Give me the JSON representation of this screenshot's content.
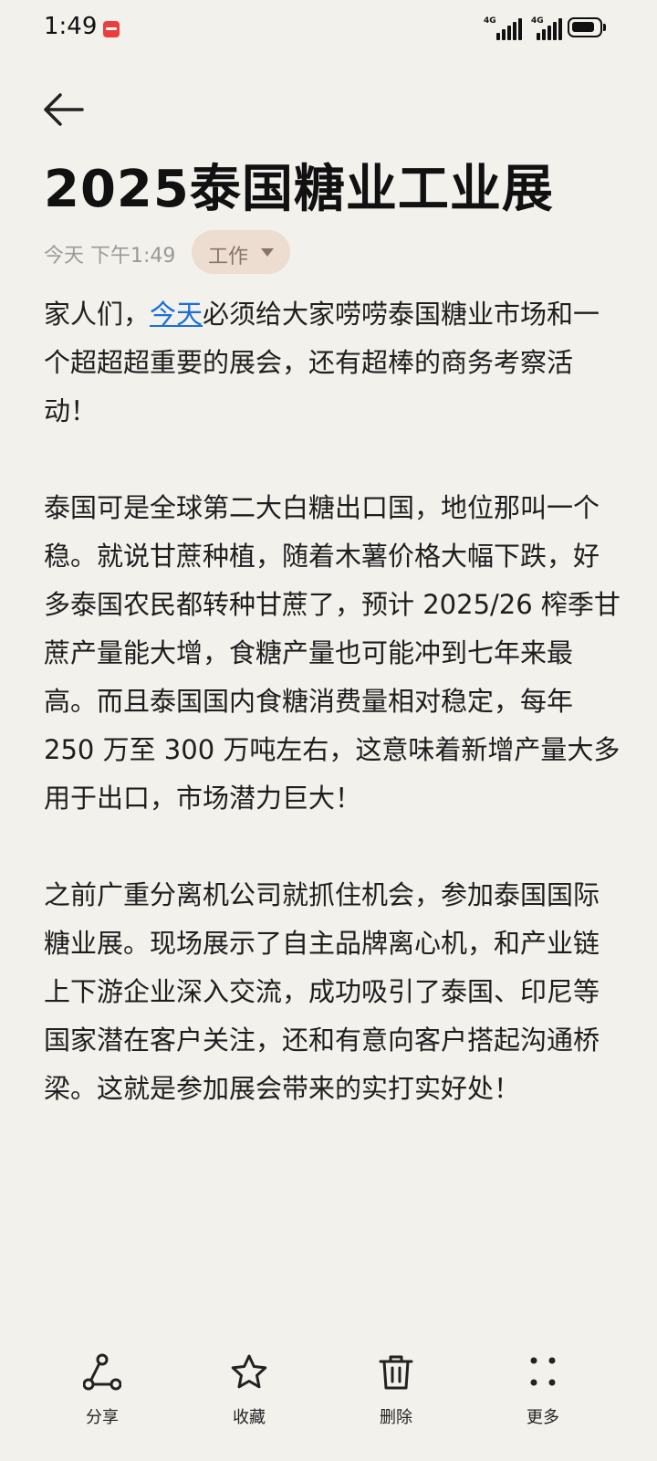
{
  "status_bar": {
    "time": "1:49",
    "net1": "4G",
    "net2": "4G"
  },
  "note": {
    "title": "2025泰国糖业工业展",
    "date": "今天 下午1:49",
    "category": "工作",
    "paragraphs": [
      {
        "prefix": "家人们，",
        "link": "今天",
        "suffix": "必须给大家唠唠泰国糖业市场和一个超超超重要的展会，还有超棒的商务考察活动！"
      },
      {
        "text": "泰国可是全球第二大白糖出口国，地位那叫一个稳。就说甘蔗种植，随着木薯价格大幅下跌，好多泰国农民都转种甘蔗了，预计 2025/26 榨季甘蔗产量能大增，食糖产量也可能冲到七年来最高。而且泰国国内食糖消费量相对稳定，每年 250 万至 300 万吨左右，这意味着新增产量大多用于出口，市场潜力巨大！"
      },
      {
        "text": "之前广重分离机公司就抓住机会，参加泰国国际糖业展。现场展示了自主品牌离心机，和产业链上下游企业深入交流，成功吸引了泰国、印尼等国家潜在客户关注，还和有意向客户搭起沟通桥梁。这就是参加展会带来的实打实好处！"
      }
    ]
  },
  "toolbar": {
    "share": "分享",
    "favorite": "收藏",
    "delete": "删除",
    "more": "更多"
  }
}
